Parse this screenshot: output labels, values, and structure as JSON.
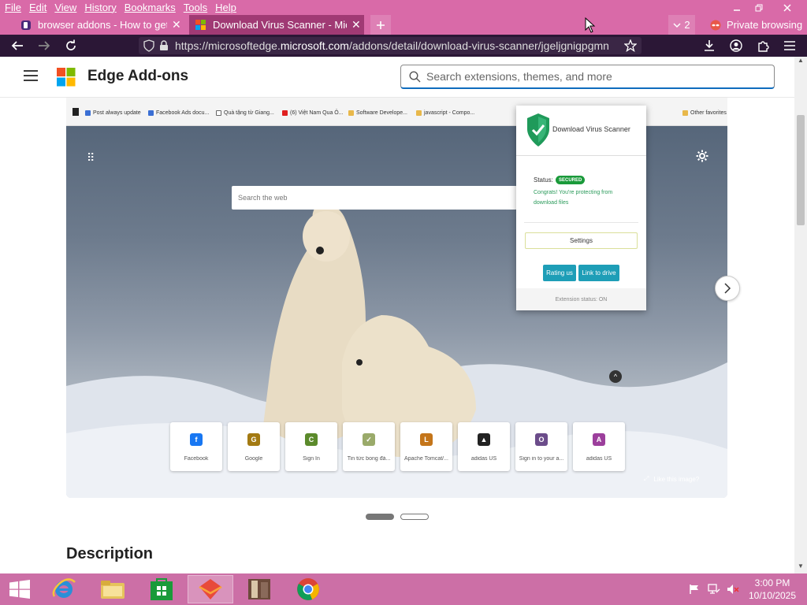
{
  "menu": [
    "File",
    "Edit",
    "View",
    "History",
    "Bookmarks",
    "Tools",
    "Help"
  ],
  "tabs": [
    {
      "title": "browser addons - How to get ra"
    },
    {
      "title": "Download Virus Scanner - Micro"
    }
  ],
  "tab_overflow_count": "2",
  "private_label": "Private browsing",
  "url": {
    "prefix": "https://microsoftedge.",
    "domain": "microsoft.com",
    "path": "/addons/detail/download-virus-scanner/jgeljgnigpgmn"
  },
  "site": {
    "title": "Edge Add-ons",
    "search_placeholder": "Search extensions, themes, and more"
  },
  "screenshot": {
    "bookmarks": [
      "Post always update",
      "Facebook Ads docu...",
      "Quà tặng từ Giang...",
      "(6) Việt Nam Qua Ô...",
      "Software Develope...",
      "javascript - Compo...",
      "Other favorites"
    ],
    "search_placeholder": "Search the web",
    "tiles": [
      {
        "letter": "f",
        "label": "Facebook",
        "color": "#1877f2"
      },
      {
        "letter": "G",
        "label": "Google",
        "color": "#a37a12"
      },
      {
        "letter": "C",
        "label": "Sign In",
        "color": "#5b8a2b"
      },
      {
        "letter": "✓",
        "label": "Tin tức bong đá...",
        "color": "#9aaa6a"
      },
      {
        "letter": "L",
        "label": "Apache Tomcat/...",
        "color": "#c4751a"
      },
      {
        "letter": "▲",
        "label": "adidas US",
        "color": "#222222"
      },
      {
        "letter": "O",
        "label": "Sign in to your a...",
        "color": "#6b4c8a"
      },
      {
        "letter": "A",
        "label": "adidas US",
        "color": "#9c3f9c"
      }
    ],
    "like_image": "Like this image?",
    "popup": {
      "title": "Download Virus Scanner",
      "status_label": "Status:",
      "status_badge": "SECURED",
      "message": "Congrats! You're protecting from download files",
      "settings": "Settings",
      "rating": "Rating us",
      "link_drive": "Link to drive",
      "footer": "Extension status: ON"
    }
  },
  "description_heading": "Description",
  "taskbar": {
    "time": "3:00 PM",
    "date": "10/10/2025"
  },
  "colors": {
    "accent": "#0f6cbd",
    "secured": "#1a9a3a",
    "popup_button": "#1e9eb7",
    "menubar": "#d96aa8",
    "navbar": "#2b1736"
  }
}
